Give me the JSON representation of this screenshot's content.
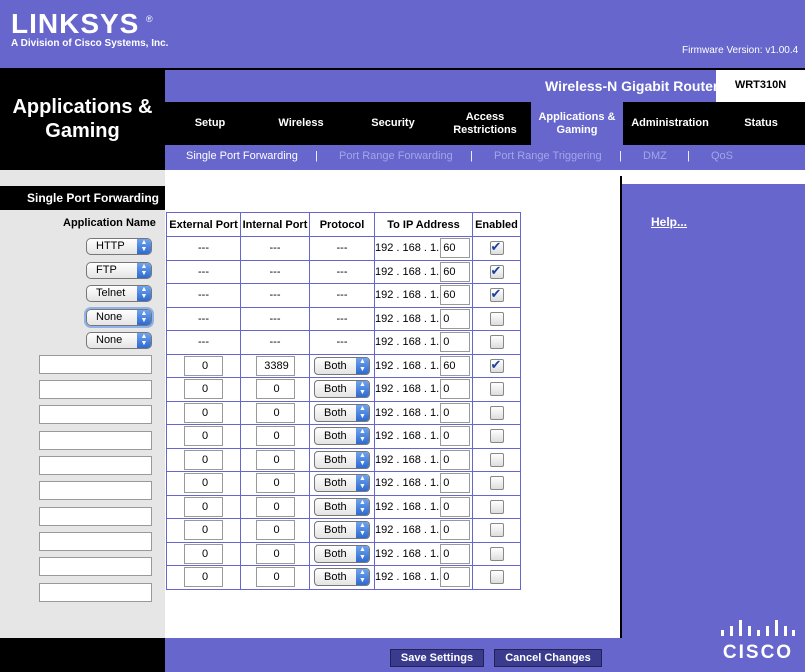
{
  "brand": {
    "logo": "LINKSYS",
    "tagline": "A Division of Cisco Systems, Inc.",
    "firmware": "Firmware Version: v1.00.4",
    "product": "Wireless-N Gigabit Router",
    "model": "WRT310N",
    "footer_logo": "CISCO"
  },
  "page": {
    "title_line1": "Applications &",
    "title_line2": "Gaming"
  },
  "nav": {
    "tabs": [
      {
        "line1": "Setup",
        "line2": ""
      },
      {
        "line1": "Wireless",
        "line2": ""
      },
      {
        "line1": "Security",
        "line2": ""
      },
      {
        "line1": "Access",
        "line2": "Restrictions"
      },
      {
        "line1": "Applications &",
        "line2": "Gaming"
      },
      {
        "line1": "Administration",
        "line2": ""
      },
      {
        "line1": "Status",
        "line2": ""
      }
    ],
    "active_tab": "Applications & Gaming"
  },
  "subnav": {
    "items": [
      "Single Port Forwarding",
      "Port Range Forwarding",
      "Port Range Triggering",
      "DMZ",
      "QoS"
    ],
    "separator": "|",
    "active": "Single Port Forwarding"
  },
  "section": {
    "title": "Single Port Forwarding",
    "help": "Help..."
  },
  "table": {
    "app_name_header": "Application Name",
    "headers": [
      "External Port",
      "Internal Port",
      "Protocol",
      "To IP Address",
      "Enabled"
    ],
    "ip_prefix": "192 . 168 . 1.",
    "preset_rows": [
      {
        "app": "HTTP",
        "ext": "---",
        "int": "---",
        "proto": "---",
        "ip": "60",
        "enabled": true
      },
      {
        "app": "FTP",
        "ext": "---",
        "int": "---",
        "proto": "---",
        "ip": "60",
        "enabled": true
      },
      {
        "app": "Telnet",
        "ext": "---",
        "int": "---",
        "proto": "---",
        "ip": "60",
        "enabled": true
      },
      {
        "app": "None",
        "ext": "---",
        "int": "---",
        "proto": "---",
        "ip": "0",
        "enabled": false
      },
      {
        "app": "None",
        "ext": "---",
        "int": "---",
        "proto": "---",
        "ip": "0",
        "enabled": false
      }
    ],
    "custom_rows": [
      {
        "name": "",
        "ext": "0",
        "int": "3389",
        "proto": "Both",
        "ip": "60",
        "enabled": true
      },
      {
        "name": "",
        "ext": "0",
        "int": "0",
        "proto": "Both",
        "ip": "0",
        "enabled": false
      },
      {
        "name": "",
        "ext": "0",
        "int": "0",
        "proto": "Both",
        "ip": "0",
        "enabled": false
      },
      {
        "name": "",
        "ext": "0",
        "int": "0",
        "proto": "Both",
        "ip": "0",
        "enabled": false
      },
      {
        "name": "",
        "ext": "0",
        "int": "0",
        "proto": "Both",
        "ip": "0",
        "enabled": false
      },
      {
        "name": "",
        "ext": "0",
        "int": "0",
        "proto": "Both",
        "ip": "0",
        "enabled": false
      },
      {
        "name": "",
        "ext": "0",
        "int": "0",
        "proto": "Both",
        "ip": "0",
        "enabled": false
      },
      {
        "name": "",
        "ext": "0",
        "int": "0",
        "proto": "Both",
        "ip": "0",
        "enabled": false
      },
      {
        "name": "",
        "ext": "0",
        "int": "0",
        "proto": "Both",
        "ip": "0",
        "enabled": false
      },
      {
        "name": "",
        "ext": "0",
        "int": "0",
        "proto": "Both",
        "ip": "0",
        "enabled": false
      }
    ]
  },
  "buttons": {
    "save": "Save Settings",
    "cancel": "Cancel Changes"
  },
  "colors": {
    "brand_purple": "#6666cc",
    "black": "#000000",
    "panel_grey": "#e6e6e6"
  }
}
